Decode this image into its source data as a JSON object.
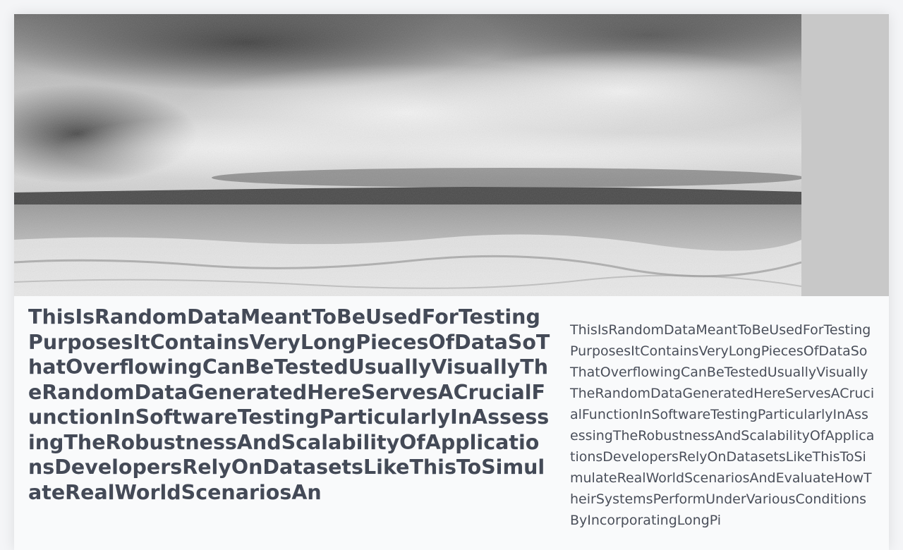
{
  "article": {
    "title": "ThisIsRandomDataMeantToBeUsedForTestingPurposesItContainsVeryLongPiecesOfDataSoThatOverflowingCanBeTestedUsuallyVisuallyTheRandomDataGeneratedHereServesACrucialFunctionInSoftwareTestingParticularlyInAssessingTheRobustnessAndScalabilityOfApplicationsDevelopersRelyOnDatasetsLikeThisToSimulateRealWorldScenariosAn",
    "description": "ThisIsRandomDataMeantToBeUsedForTestingPurposesItContainsVeryLongPiecesOfDataSoThatOverflowingCanBeTestedUsuallyVisuallyTheRandomDataGeneratedHereServesACrucialFunctionInSoftwareTestingParticularlyInAssessingTheRobustnessAndScalabilityOfApplicationsDevelopersRelyOnDatasetsLikeThisToSimulateRealWorldScenariosAndEvaluateHowTheirSystemsPerformUnderVariousConditionsByIncorporatingLongPi"
  },
  "hero": {
    "image": "grayscale-beach-seascape-photo"
  },
  "colors": {
    "title_text": "#444a57",
    "body_text": "#4a4f5a",
    "card_background": "#f9fafb",
    "image_placeholder": "#c8c8c8"
  }
}
